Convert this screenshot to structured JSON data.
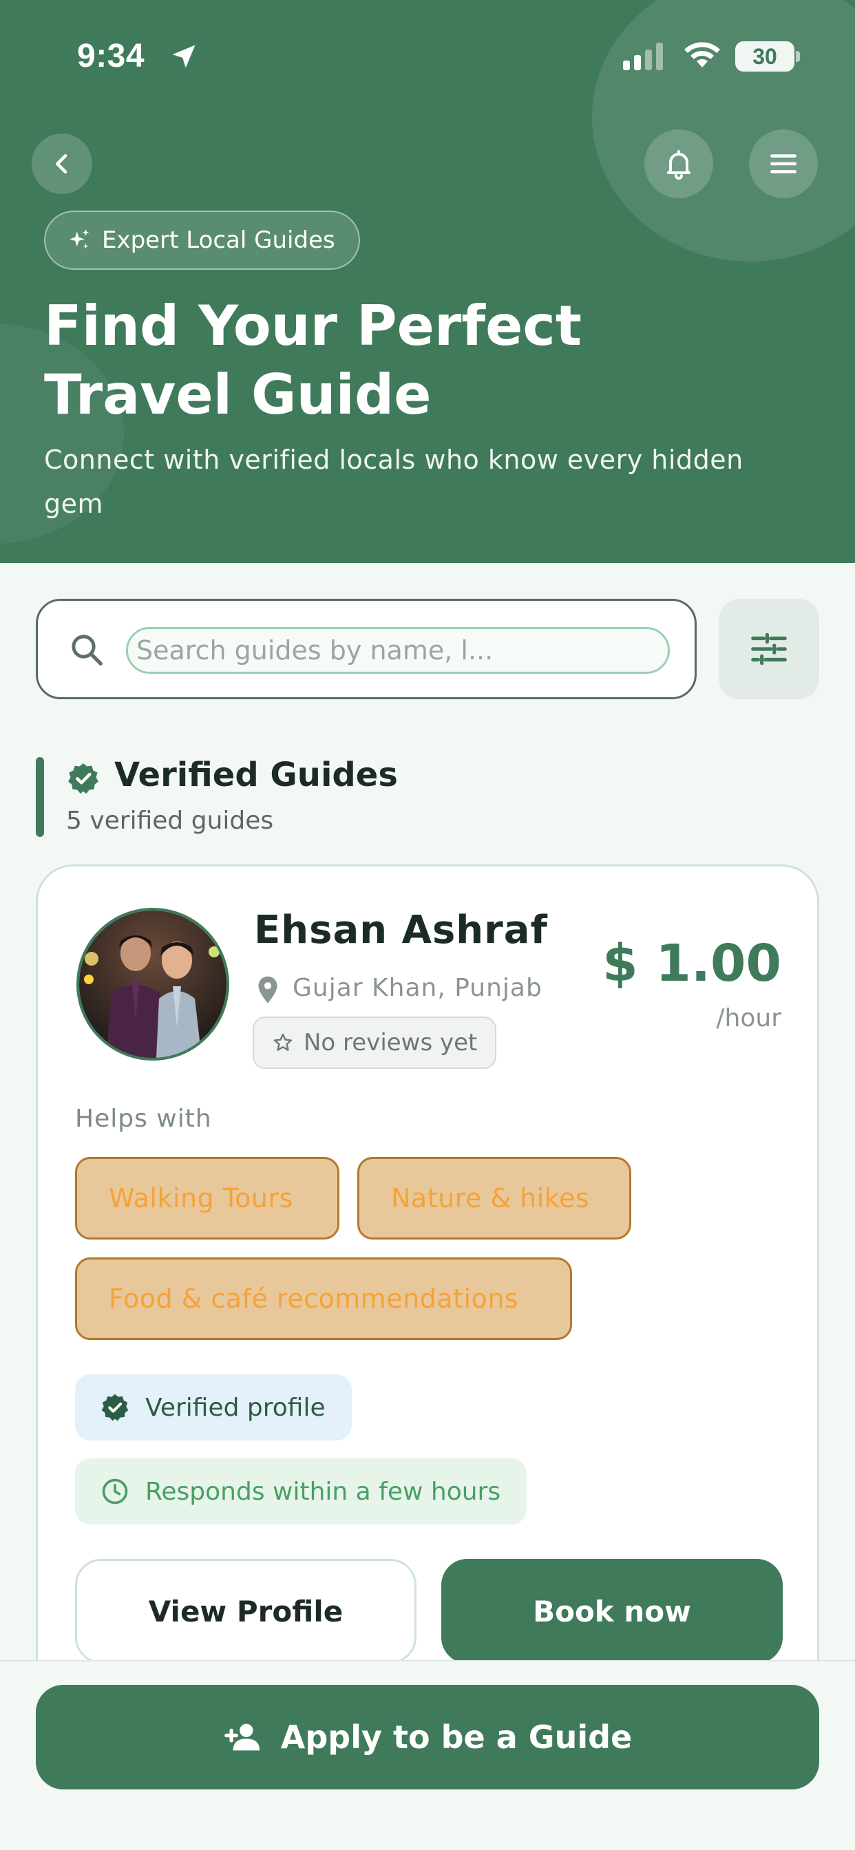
{
  "status_bar": {
    "time": "9:34",
    "battery": "30"
  },
  "header": {
    "chip_label": "Expert Local Guides",
    "title_line1": "Find Your Perfect",
    "title_line2": "Travel Guide",
    "subtitle": "Connect with verified locals who know every hidden gem"
  },
  "search": {
    "placeholder": "Search guides by name, l..."
  },
  "section": {
    "title": "Verified Guides",
    "count": "5 verified guides"
  },
  "guides": [
    {
      "name": "Ehsan Ashraf",
      "location": "Gujar Khan, Punjab",
      "reviews": "No reviews yet",
      "price": "$ 1.00",
      "price_unit": "/hour",
      "helps_label": "Helps with",
      "tags": [
        "Walking Tours",
        "Nature & hikes",
        "Food & café recommendations"
      ],
      "badge_verified": "Verified profile",
      "badge_responds": "Responds within a few hours",
      "view_label": "View Profile",
      "book_label": "Book now"
    }
  ],
  "bottom": {
    "apply_label": "Apply to be a Guide"
  },
  "colors": {
    "primary": "#3f7a5b",
    "tag_bg": "#e8c89a",
    "tag_text": "#f4a338",
    "verified_bg": "#e4f1fb",
    "responds_bg": "#e6f4ea"
  }
}
